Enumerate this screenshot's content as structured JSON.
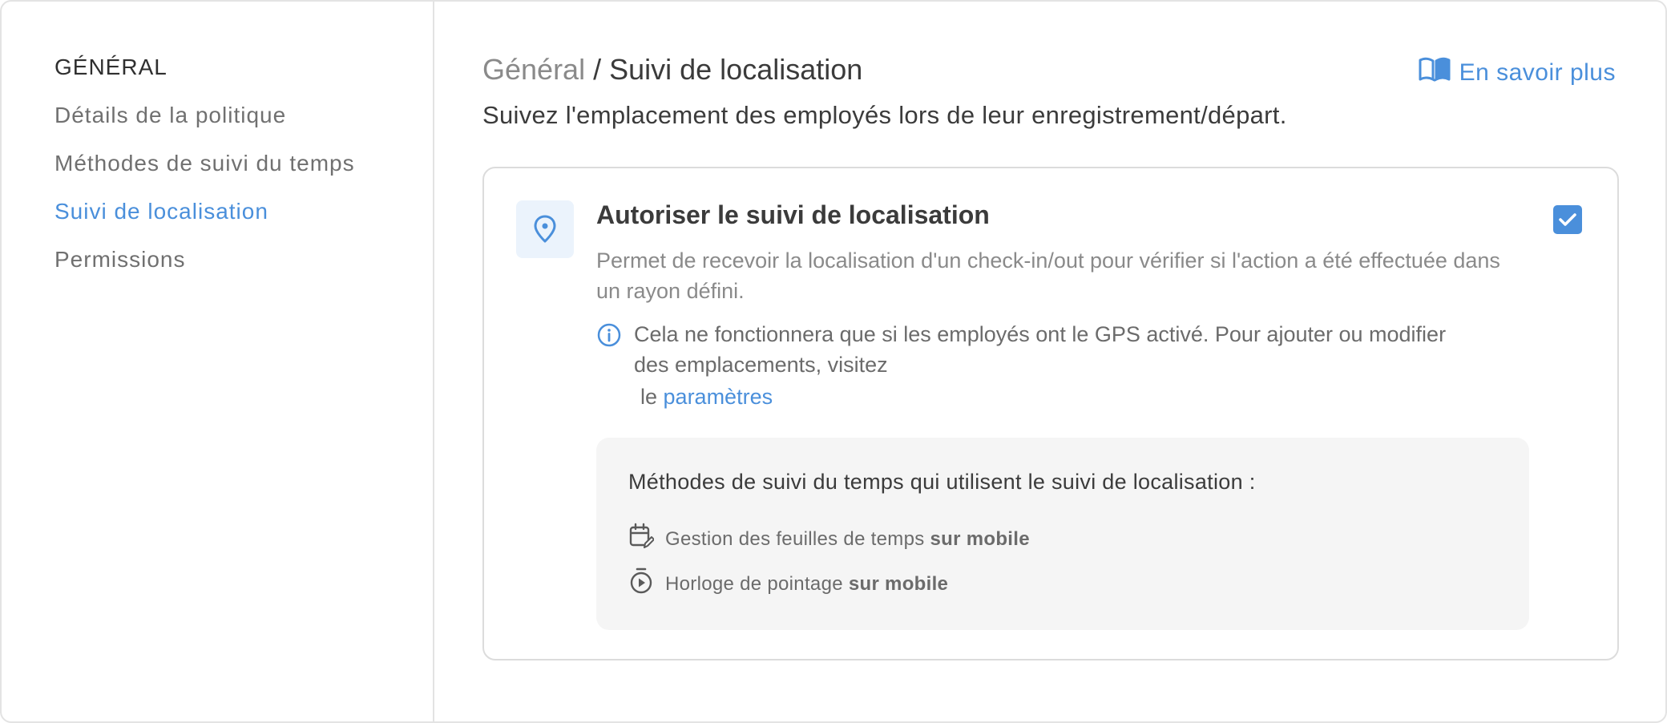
{
  "sidebar": {
    "heading": "GÉNÉRAL",
    "items": [
      {
        "label": "Détails de la politique",
        "active": false
      },
      {
        "label": "Méthodes de suivi du temps",
        "active": false
      },
      {
        "label": "Suivi de localisation",
        "active": true
      },
      {
        "label": "Permissions",
        "active": false
      }
    ]
  },
  "header": {
    "breadcrumb_parent": "Général",
    "breadcrumb_separator": " / ",
    "breadcrumb_current": "Suivi de localisation",
    "learn_more": "En savoir plus",
    "learn_more_icon": "book-icon",
    "subtitle": "Suivez l'emplacement des employés lors de leur enregistrement/départ."
  },
  "card": {
    "icon": "location-pin-icon",
    "title": "Autoriser le suivi de localisation",
    "checked": true,
    "description": "Permet de recevoir la localisation d'un check-in/out pour vérifier si l'action a été effectuée dans un rayon défini.",
    "info_text": "Cela ne fonctionnera que si les employés ont le GPS activé. Pour ajouter ou modifier des emplacements, visitez",
    "info_link_prefix": "le",
    "info_link": "paramètres",
    "methods": {
      "title": "Méthodes de suivi du temps qui utilisent le suivi de localisation :",
      "items": [
        {
          "icon": "calendar-edit-icon",
          "text": "Gestion des feuilles de temps",
          "bold": "sur mobile"
        },
        {
          "icon": "stopwatch-icon",
          "text": "Horloge de pointage",
          "bold": "sur mobile"
        }
      ]
    }
  },
  "colors": {
    "accent": "#4a8fdb",
    "border": "#e3e3e3",
    "muted_text": "#8a8a8a"
  }
}
